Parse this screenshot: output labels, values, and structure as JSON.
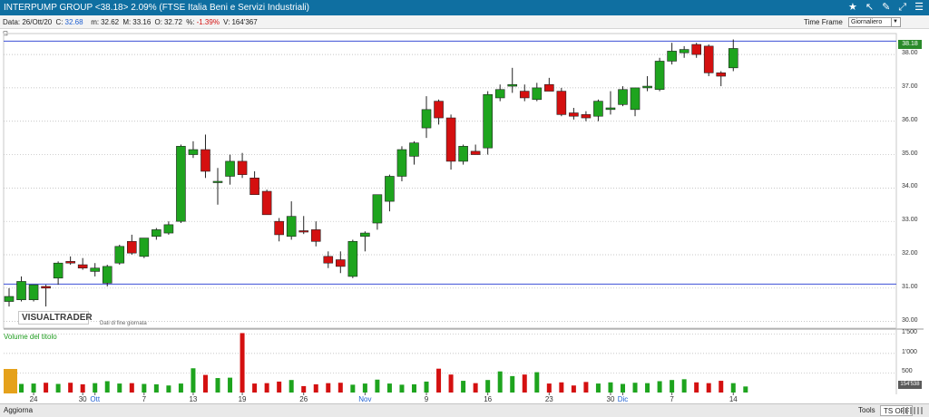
{
  "header": {
    "title": "INTERPUMP GROUP <38.18> 2.09%  (FTSE Italia Beni e Servizi Industriali)",
    "icons": [
      "star-icon",
      "cursor-icon",
      "wrench-icon",
      "export-icon",
      "menu-icon"
    ]
  },
  "info": {
    "date": "Data: 26/Ott/20",
    "close_label": "C:",
    "close_value": "32.68",
    "low_label": "m:",
    "low_value": "32.62",
    "high_label": "M:",
    "high_value": "33.16",
    "open_label": "O:",
    "open_value": "32.72",
    "pct_label": "%:",
    "pct_value": "-1.39%",
    "volume_label": "V:",
    "volume_value": "164'367"
  },
  "timeframe": {
    "label": "Time Frame",
    "selected": "Giornaliero"
  },
  "watermark": {
    "brand": "VISUALTRADER",
    "subtitle": "Dati di fine giornata"
  },
  "volume_panel": {
    "title": "Volume del titolo",
    "current": "154'538"
  },
  "price_axis": {
    "current_tag": "38.18"
  },
  "status": {
    "update_label": "Aggiorna",
    "tools_label": "Tools",
    "ts_label": "TS OFF"
  },
  "colors": {
    "up": "#1ea41e",
    "down": "#d41010",
    "titlebar": "#0f6fa1",
    "hline": "#3c4fd6",
    "accent_tab": "#e5a11b"
  },
  "chart_data": [
    {
      "type": "candlestick",
      "ylim": [
        29.8,
        38.6
      ],
      "yticks": [
        "30.00",
        "31.00",
        "32.00",
        "33.00",
        "34.00",
        "35.00",
        "36.00",
        "37.00",
        "38.00"
      ],
      "ytick_values": [
        30,
        31,
        32,
        33,
        34,
        35,
        36,
        37,
        38
      ],
      "horizontal_lines": [
        38.4,
        31.12
      ],
      "x_ticks": [
        {
          "label": "24",
          "index": 2,
          "month": false
        },
        {
          "label": "30",
          "index": 6,
          "month": false
        },
        {
          "label": "Ott",
          "index": 7,
          "month": true
        },
        {
          "label": "7",
          "index": 11,
          "month": false
        },
        {
          "label": "13",
          "index": 15,
          "month": false
        },
        {
          "label": "19",
          "index": 19,
          "month": false
        },
        {
          "label": "26",
          "index": 24,
          "month": false
        },
        {
          "label": "Nov",
          "index": 29,
          "month": true
        },
        {
          "label": "9",
          "index": 34,
          "month": false
        },
        {
          "label": "16",
          "index": 39,
          "month": false
        },
        {
          "label": "23",
          "index": 44,
          "month": false
        },
        {
          "label": "30",
          "index": 49,
          "month": false
        },
        {
          "label": "Dic",
          "index": 50,
          "month": true
        },
        {
          "label": "7",
          "index": 54,
          "month": false
        },
        {
          "label": "14",
          "index": 59,
          "month": false
        }
      ],
      "candles": [
        {
          "o": 30.6,
          "h": 31.0,
          "l": 30.45,
          "c": 30.75
        },
        {
          "o": 30.65,
          "h": 31.35,
          "l": 30.6,
          "c": 31.2
        },
        {
          "o": 30.65,
          "h": 31.1,
          "l": 30.6,
          "c": 31.1
        },
        {
          "o": 31.05,
          "h": 31.1,
          "l": 30.45,
          "c": 31.0
        },
        {
          "o": 31.3,
          "h": 31.8,
          "l": 31.1,
          "c": 31.75
        },
        {
          "o": 31.8,
          "h": 31.95,
          "l": 31.7,
          "c": 31.75
        },
        {
          "o": 31.7,
          "h": 31.9,
          "l": 31.55,
          "c": 31.6
        },
        {
          "o": 31.5,
          "h": 31.75,
          "l": 31.35,
          "c": 31.6
        },
        {
          "o": 31.15,
          "h": 31.7,
          "l": 31.05,
          "c": 31.65
        },
        {
          "o": 31.75,
          "h": 32.3,
          "l": 31.7,
          "c": 32.25
        },
        {
          "o": 32.4,
          "h": 32.6,
          "l": 32.0,
          "c": 32.05
        },
        {
          "o": 31.95,
          "h": 32.5,
          "l": 31.9,
          "c": 32.5
        },
        {
          "o": 32.55,
          "h": 32.8,
          "l": 32.45,
          "c": 32.75
        },
        {
          "o": 32.65,
          "h": 33.0,
          "l": 32.6,
          "c": 32.9
        },
        {
          "o": 33.0,
          "h": 35.3,
          "l": 32.95,
          "c": 35.25
        },
        {
          "o": 35.0,
          "h": 35.4,
          "l": 34.9,
          "c": 35.15
        },
        {
          "o": 35.15,
          "h": 35.6,
          "l": 34.3,
          "c": 34.5
        },
        {
          "o": 34.2,
          "h": 34.6,
          "l": 33.5,
          "c": 34.2
        },
        {
          "o": 34.35,
          "h": 35.0,
          "l": 34.1,
          "c": 34.8
        },
        {
          "o": 34.8,
          "h": 35.05,
          "l": 34.3,
          "c": 34.4
        },
        {
          "o": 34.3,
          "h": 34.5,
          "l": 33.8,
          "c": 33.8
        },
        {
          "o": 33.9,
          "h": 33.95,
          "l": 33.2,
          "c": 33.2
        },
        {
          "o": 33.0,
          "h": 33.1,
          "l": 32.4,
          "c": 32.6
        },
        {
          "o": 32.55,
          "h": 33.6,
          "l": 32.45,
          "c": 33.15
        },
        {
          "o": 32.72,
          "h": 33.16,
          "l": 32.62,
          "c": 32.68
        },
        {
          "o": 32.75,
          "h": 33.0,
          "l": 32.25,
          "c": 32.4
        },
        {
          "o": 31.95,
          "h": 32.1,
          "l": 31.6,
          "c": 31.75
        },
        {
          "o": 31.85,
          "h": 32.1,
          "l": 31.45,
          "c": 31.65
        },
        {
          "o": 31.35,
          "h": 32.45,
          "l": 31.3,
          "c": 32.4
        },
        {
          "o": 32.55,
          "h": 32.7,
          "l": 32.1,
          "c": 32.65
        },
        {
          "o": 32.95,
          "h": 33.8,
          "l": 32.75,
          "c": 33.8
        },
        {
          "o": 33.6,
          "h": 34.4,
          "l": 33.3,
          "c": 34.35
        },
        {
          "o": 34.35,
          "h": 35.25,
          "l": 34.2,
          "c": 35.15
        },
        {
          "o": 34.95,
          "h": 35.4,
          "l": 34.7,
          "c": 35.35
        },
        {
          "o": 35.8,
          "h": 36.75,
          "l": 35.5,
          "c": 36.35
        },
        {
          "o": 36.6,
          "h": 36.65,
          "l": 35.9,
          "c": 36.1
        },
        {
          "o": 36.1,
          "h": 36.2,
          "l": 34.55,
          "c": 34.8
        },
        {
          "o": 34.8,
          "h": 35.3,
          "l": 34.7,
          "c": 35.25
        },
        {
          "o": 35.1,
          "h": 35.3,
          "l": 35.0,
          "c": 35.0
        },
        {
          "o": 35.2,
          "h": 36.9,
          "l": 35.0,
          "c": 36.8
        },
        {
          "o": 36.7,
          "h": 37.1,
          "l": 36.6,
          "c": 36.95
        },
        {
          "o": 37.05,
          "h": 37.6,
          "l": 36.85,
          "c": 37.1
        },
        {
          "o": 36.9,
          "h": 37.1,
          "l": 36.6,
          "c": 36.7
        },
        {
          "o": 36.65,
          "h": 37.15,
          "l": 36.6,
          "c": 37.0
        },
        {
          "o": 37.1,
          "h": 37.3,
          "l": 36.9,
          "c": 36.9
        },
        {
          "o": 36.9,
          "h": 37.0,
          "l": 36.15,
          "c": 36.2
        },
        {
          "o": 36.25,
          "h": 36.4,
          "l": 36.05,
          "c": 36.15
        },
        {
          "o": 36.2,
          "h": 36.3,
          "l": 36.0,
          "c": 36.1
        },
        {
          "o": 36.15,
          "h": 36.65,
          "l": 36.0,
          "c": 36.6
        },
        {
          "o": 36.35,
          "h": 36.9,
          "l": 36.2,
          "c": 36.4
        },
        {
          "o": 36.5,
          "h": 37.05,
          "l": 36.45,
          "c": 36.95
        },
        {
          "o": 36.35,
          "h": 37.0,
          "l": 36.15,
          "c": 37.0
        },
        {
          "o": 37.0,
          "h": 37.35,
          "l": 36.9,
          "c": 37.05
        },
        {
          "o": 36.95,
          "h": 37.9,
          "l": 36.9,
          "c": 37.8
        },
        {
          "o": 37.8,
          "h": 38.35,
          "l": 37.7,
          "c": 38.1
        },
        {
          "o": 38.05,
          "h": 38.25,
          "l": 37.9,
          "c": 38.15
        },
        {
          "o": 38.3,
          "h": 38.35,
          "l": 37.9,
          "c": 38.0
        },
        {
          "o": 38.25,
          "h": 38.3,
          "l": 37.35,
          "c": 37.45
        },
        {
          "o": 37.45,
          "h": 37.5,
          "l": 37.05,
          "c": 37.35
        },
        {
          "o": 37.6,
          "h": 38.45,
          "l": 37.5,
          "c": 38.18
        }
      ]
    },
    {
      "type": "bar",
      "title": "Volume del titolo",
      "ylim": [
        0,
        1600000
      ],
      "yticks": [
        "500",
        "1'000",
        "1'500"
      ],
      "ytick_values": [
        500000,
        1000000,
        1500000
      ],
      "values": [
        280000,
        220000,
        230000,
        250000,
        220000,
        250000,
        210000,
        240000,
        290000,
        230000,
        240000,
        220000,
        210000,
        180000,
        230000,
        620000,
        450000,
        370000,
        380000,
        1520000,
        230000,
        240000,
        280000,
        320000,
        164367,
        210000,
        240000,
        250000,
        200000,
        230000,
        330000,
        230000,
        200000,
        210000,
        280000,
        610000,
        460000,
        300000,
        240000,
        320000,
        540000,
        420000,
        460000,
        520000,
        230000,
        260000,
        180000,
        270000,
        230000,
        260000,
        220000,
        250000,
        240000,
        290000,
        320000,
        340000,
        260000,
        240000,
        300000,
        240000,
        154538
      ]
    }
  ]
}
